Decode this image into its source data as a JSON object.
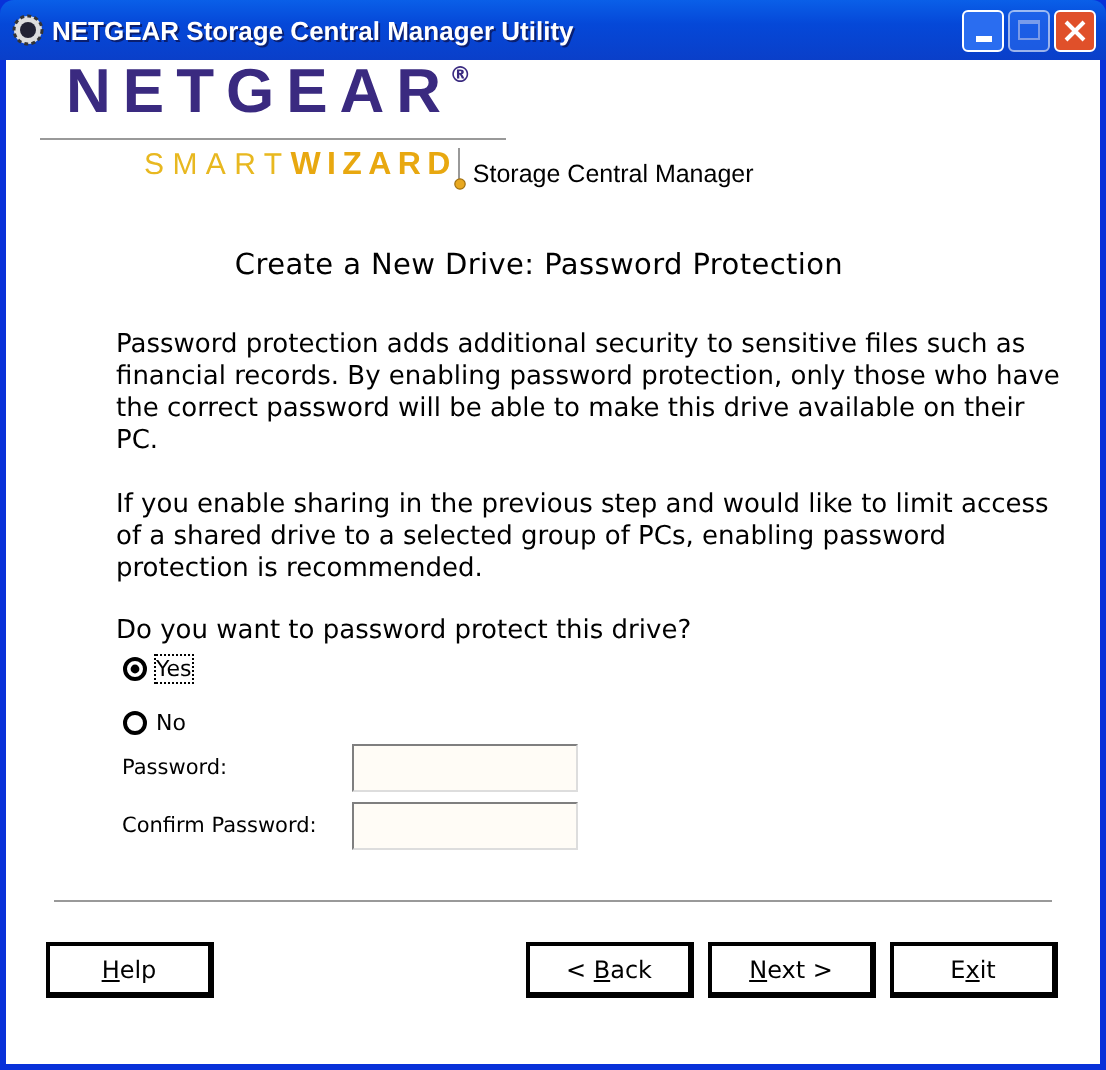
{
  "window": {
    "title": "NETGEAR Storage Central Manager Utility"
  },
  "logo": {
    "brand": "NETGEAR",
    "reg": "®",
    "smart": "SMART",
    "wizard": "WIZARD",
    "product": "Storage Central Manager"
  },
  "heading": "Create a New Drive: Password Protection",
  "paragraphs": [
    "Password protection adds additional security to sensitive files such as financial records. By enabling password protection, only those who have the correct password will be able to make this drive available on their PC.",
    "If you enable sharing in the previous step and would like to limit access of a shared drive to a selected group of PCs, enabling password protection is recommended."
  ],
  "question": "Do you want to password protect this drive?",
  "options": [
    {
      "label": "Yes",
      "selected": true
    },
    {
      "label": "No",
      "selected": false
    }
  ],
  "fields": [
    {
      "label": "Password:"
    },
    {
      "label": "Confirm Password:"
    }
  ],
  "buttons": [
    {
      "kind": "left",
      "key": "H",
      "post": "elp"
    },
    {
      "kind": "right",
      "pre": "< ",
      "key": "B",
      "post": "ack"
    },
    {
      "kind": "right",
      "key": "N",
      "post": "ext >"
    },
    {
      "kind": "right",
      "pre": "E",
      "key": "x",
      "post": "it"
    }
  ]
}
